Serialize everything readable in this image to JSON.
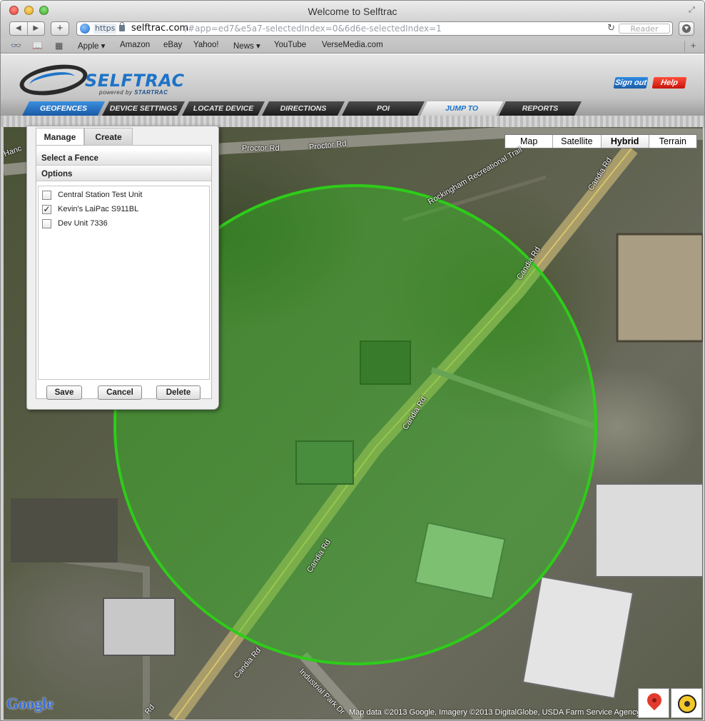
{
  "browser": {
    "window_title": "Welcome to Selftrac",
    "url_scheme": "https",
    "url_host": "selftrac.com",
    "url_path": "/#app=ed7&e5a7-selectedIndex=0&6d6e-selectedIndex=1",
    "reader_label": "Reader",
    "nav_back": "◀",
    "nav_forward": "▶",
    "add_label": "+",
    "reload_glyph": "↻",
    "bookmarks": [
      {
        "label": "Apple ▾"
      },
      {
        "label": "Amazon"
      },
      {
        "label": "eBay"
      },
      {
        "label": "Yahoo!"
      },
      {
        "label": "News ▾"
      },
      {
        "label": "YouTube"
      },
      {
        "label": "VerseMedia.com"
      }
    ]
  },
  "app": {
    "logo_text": "SELFTRAC",
    "logo_sub_prefix": "powered by",
    "logo_sub_brand": "STARTRAC",
    "signout_label": "Sign out",
    "help_label": "Help",
    "tabs": [
      {
        "label": "GEOFENCES"
      },
      {
        "label": "DEVICE SETTINGS"
      },
      {
        "label": "LOCATE DEVICE"
      },
      {
        "label": "DIRECTIONS"
      },
      {
        "label": "POI"
      },
      {
        "label": "JUMP TO"
      },
      {
        "label": "REPORTS"
      }
    ],
    "brand_color": "#1e73c8"
  },
  "panel": {
    "tabs": [
      {
        "label": "Manage"
      },
      {
        "label": "Create"
      }
    ],
    "select_fence_label": "Select a Fence",
    "options_label": "Options",
    "fences": [
      {
        "label": "Central Station Test Unit",
        "checked": false
      },
      {
        "label": "Kevin's LaiPac S911BL",
        "checked": true
      },
      {
        "label": "Dev Unit 7336",
        "checked": false
      }
    ],
    "save_label": "Save",
    "cancel_label": "Cancel",
    "delete_label": "Delete"
  },
  "map": {
    "types": [
      {
        "label": "Map",
        "selected": false
      },
      {
        "label": "Satellite",
        "selected": false
      },
      {
        "label": "Hybrid",
        "selected": true
      },
      {
        "label": "Terrain",
        "selected": false
      }
    ],
    "road_labels": [
      {
        "label": "Proctor Rd"
      },
      {
        "label": "Proctor Rd"
      },
      {
        "label": "Rockingham Recreational Trail"
      },
      {
        "label": "Candia Rd"
      },
      {
        "label": "Candia Rd"
      },
      {
        "label": "Candia Rd"
      },
      {
        "label": "Candia Rd"
      },
      {
        "label": "Candia Rd"
      },
      {
        "label": "Industrial Park Dr"
      },
      {
        "label": "Hanc"
      },
      {
        "label": "Rd"
      }
    ],
    "google_label": "Google",
    "attribution": "Map data ©2013  Google, Imagery ©2013  DigitalGlobe, USDA Farm Service Agency",
    "fence_color": "#2ecc1a"
  }
}
